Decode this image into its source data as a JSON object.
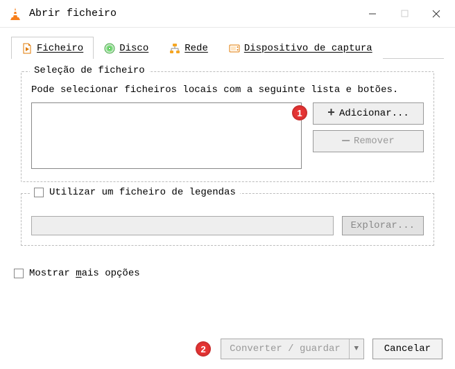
{
  "window": {
    "title": "Abrir ficheiro"
  },
  "tabs": {
    "file": "Ficheiro",
    "disc": "Disco",
    "network": "Rede",
    "capture": "Dispositivo de captura"
  },
  "file_group": {
    "title": "Seleção de ficheiro",
    "instruction": "Pode selecionar ficheiros locais com a seguinte lista e botões.",
    "add_button": "Adicionar...",
    "remove_button": "Remover"
  },
  "subtitle_group": {
    "checkbox_label": "Utilizar um ficheiro de legendas",
    "browse_button": "Explorar..."
  },
  "bottom": {
    "more_options": "Mostrar mais opções"
  },
  "footer": {
    "convert_save": "Converter / guardar",
    "cancel": "Cancelar"
  },
  "callouts": {
    "c1": "1",
    "c2": "2"
  }
}
